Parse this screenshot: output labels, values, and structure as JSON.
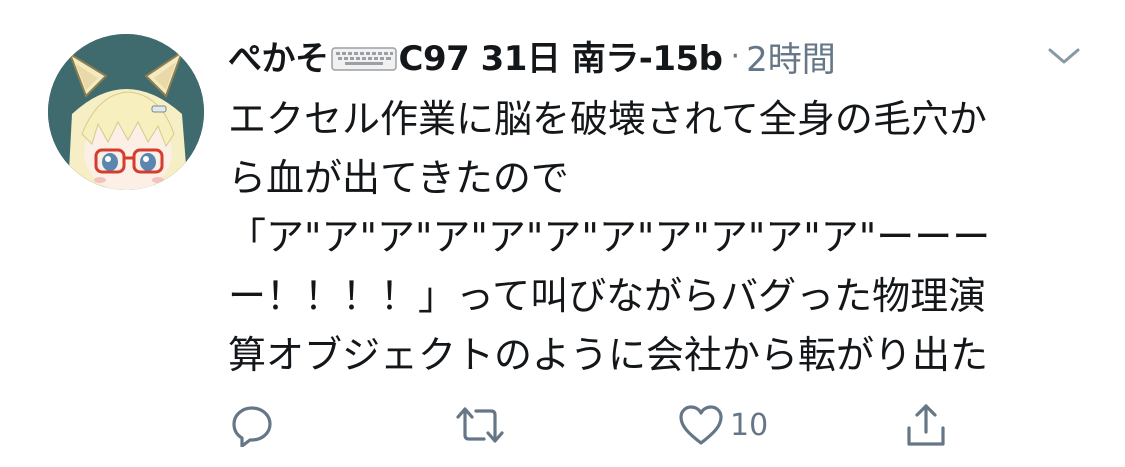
{
  "tweet": {
    "display_name_part1": "ぺかそ",
    "display_name_part2": "C97 31日 南ラ-15b",
    "separator": "·",
    "time": "2時間",
    "text_lines": [
      "エクセル作業に脳を破壊されて全身の毛穴か",
      "ら血が出てきたので",
      "「ア\"ア\"ア\"ア\"ア\"ア\"ア\"ア\"ア\"ア\"ア\"ーーー",
      "ー！！！！」って叫びながらバグった物理演",
      "算オブジェクトのように会社から転がり出た"
    ],
    "actions": {
      "reply_icon": "reply-icon",
      "retweet_icon": "retweet-icon",
      "like_icon": "heart-icon",
      "like_count": "10",
      "share_icon": "share-icon"
    }
  },
  "colors": {
    "text": "#14171a",
    "muted": "#657786",
    "avatar_bg": "#3f6b6e"
  }
}
